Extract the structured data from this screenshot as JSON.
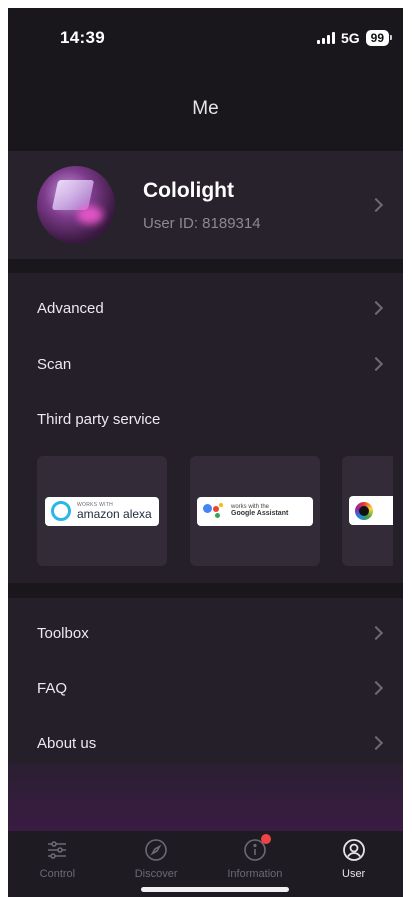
{
  "status_bar": {
    "time": "14:39",
    "network": "5G",
    "battery": "99"
  },
  "header": {
    "title": "Me"
  },
  "profile": {
    "name": "Cololight",
    "user_id": "User ID: 8189314"
  },
  "menu_top": [
    {
      "label": "Advanced"
    },
    {
      "label": "Scan"
    },
    {
      "label": "Third party service"
    }
  ],
  "services": [
    {
      "name": "amazon-alexa",
      "small": "WORKS WITH",
      "big": "amazon alexa"
    },
    {
      "name": "google-assistant",
      "small": "works with the",
      "big": "Google Assistant"
    },
    {
      "name": "third-service",
      "small": "",
      "big": ""
    }
  ],
  "menu_bottom": [
    {
      "label": "Toolbox"
    },
    {
      "label": "FAQ"
    },
    {
      "label": "About us"
    }
  ],
  "tabs": [
    {
      "label": "Control",
      "icon": "sliders-icon",
      "active": false
    },
    {
      "label": "Discover",
      "icon": "compass-icon",
      "active": false
    },
    {
      "label": "Information",
      "icon": "info-icon",
      "active": false,
      "badge": true
    },
    {
      "label": "User",
      "icon": "user-icon",
      "active": true
    }
  ],
  "colors": {
    "background": "#1a171c",
    "card": "#27222b",
    "badge": "#ef4444"
  }
}
